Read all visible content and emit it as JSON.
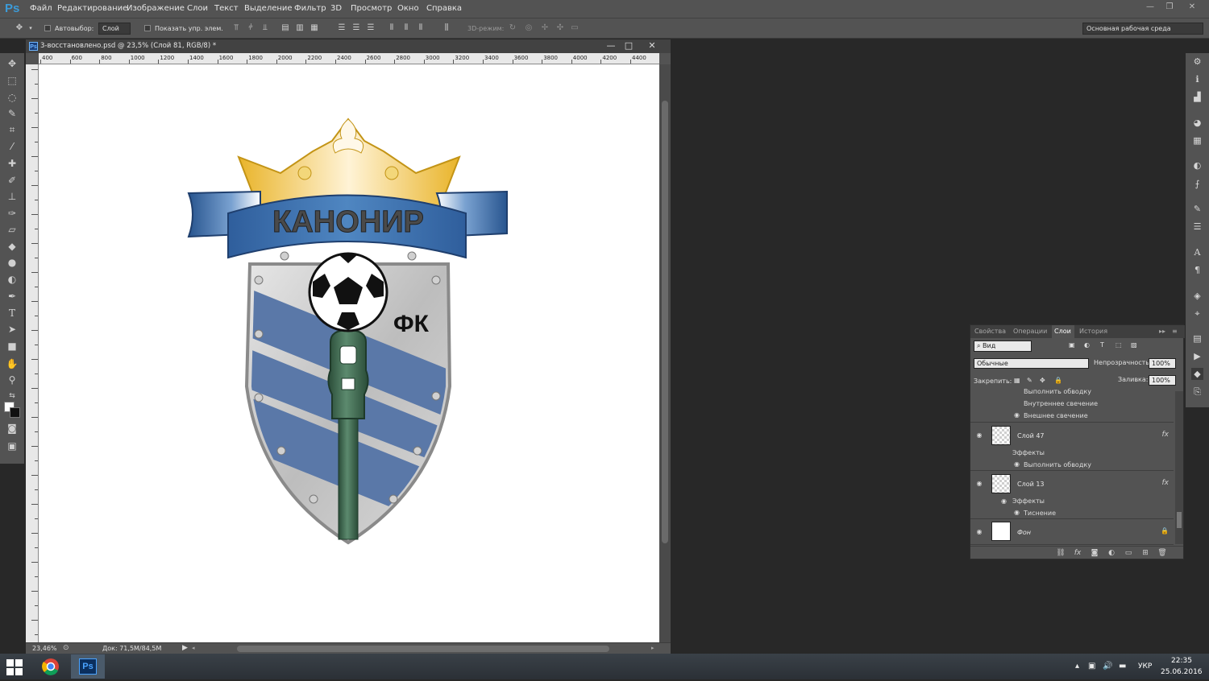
{
  "app": {
    "logo": "Ps"
  },
  "menu": [
    "Файл",
    "Редактирование",
    "Изображение",
    "Слои",
    "Текст",
    "Выделение",
    "Фильтр",
    "3D",
    "Просмотр",
    "Окно",
    "Справка"
  ],
  "options": {
    "autoselect_label": "Автовыбор:",
    "autoselect_value": "Слой",
    "show_transform_label": "Показать упр. элем.",
    "mode3d_label": "3D-режим:",
    "workspace": "Основная рабочая среда"
  },
  "document": {
    "title": "3-восстановлено.psd @ 23,5% (Слой 81, RGB/8) *",
    "ruler_ticks": [
      "400",
      "600",
      "800",
      "1000",
      "1200",
      "1400",
      "1600",
      "1800",
      "2000",
      "2200",
      "2400",
      "2600",
      "2800",
      "3000",
      "3200",
      "3400",
      "3600",
      "3800",
      "4000",
      "4200",
      "4400"
    ],
    "zoom": "23,46%",
    "doc_info": "Док: 71,5M/84,5M"
  },
  "artwork": {
    "banner_text": "КАНОНИР",
    "monogram": "ФК"
  },
  "layers_panel": {
    "tabs": [
      "Свойства",
      "Операции",
      "Слои",
      "История"
    ],
    "active_tab": "Слои",
    "filter": "Вид",
    "blend_mode": "Обычные",
    "opacity_label": "Непрозрачность:",
    "opacity": "100%",
    "lock_label": "Закрепить:",
    "fill_label": "Заливка:",
    "fill": "100%",
    "top_effects": [
      "Выполнить обводку",
      "Внутреннее свечение",
      "Внешнее свечение"
    ],
    "layers": [
      {
        "name": "Слой 47",
        "effects_label": "Эффекты",
        "effects": [
          "Выполнить обводку"
        ],
        "fx": "fx"
      },
      {
        "name": "Слой 13",
        "effects_label": "Эффекты",
        "effects": [
          "Тиснение"
        ],
        "fx": "fx"
      },
      {
        "name": "Фон"
      }
    ]
  },
  "taskbar": {
    "lang": "УКР",
    "time": "22:35",
    "date": "25.06.2016",
    "ps_label": "Ps"
  },
  "colors": {
    "accent": "#3c9bd8",
    "shield_stripe": "#5a78a8",
    "crown": "#f1c232",
    "pole": "#3d6b52"
  }
}
